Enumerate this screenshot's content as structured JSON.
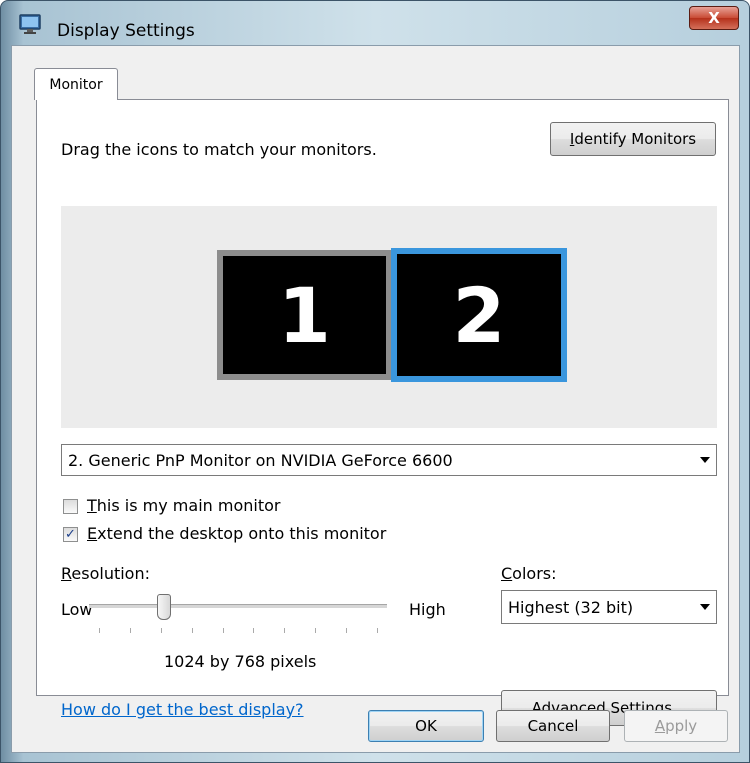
{
  "window": {
    "title": "Display Settings",
    "close_label": "X"
  },
  "tabs": [
    {
      "label": "Monitor",
      "selected": true
    }
  ],
  "monitor_tab": {
    "instruction": "Drag the icons to match your monitors.",
    "identify_button": {
      "prefix": "",
      "hotkey": "I",
      "rest": "dentify Monitors"
    },
    "monitors": [
      {
        "number": "1",
        "selected": false
      },
      {
        "number": "2",
        "selected": true
      }
    ],
    "monitor_select": {
      "value": "2. Generic PnP Monitor on NVIDIA GeForce 6600"
    },
    "main_monitor_checkbox": {
      "hotkey": "T",
      "rest": "his is my main monitor",
      "checked": false
    },
    "extend_checkbox": {
      "hotkey": "E",
      "rest": "xtend the desktop onto this monitor",
      "checked": true
    },
    "resolution": {
      "label_hotkey": "R",
      "label_rest": "esolution:",
      "low_label": "Low",
      "high_label": "High",
      "value_text": "1024 by 768 pixels",
      "slider_position_fraction": 0.25
    },
    "colors": {
      "label_hotkey": "C",
      "label_rest": "olors:",
      "value": "Highest (32 bit)"
    },
    "help_link": "How do I get the best display?",
    "advanced_button": {
      "prefix": "Ad",
      "hotkey": "v",
      "rest": "anced Settings..."
    }
  },
  "footer": {
    "ok_label": "OK",
    "cancel_label": "Cancel",
    "apply_hotkey": "A",
    "apply_rest": "pply"
  },
  "colors": {
    "accent_selected_monitor": "#3a96dd",
    "link": "#0066cc",
    "close_button": "#c94a34"
  }
}
